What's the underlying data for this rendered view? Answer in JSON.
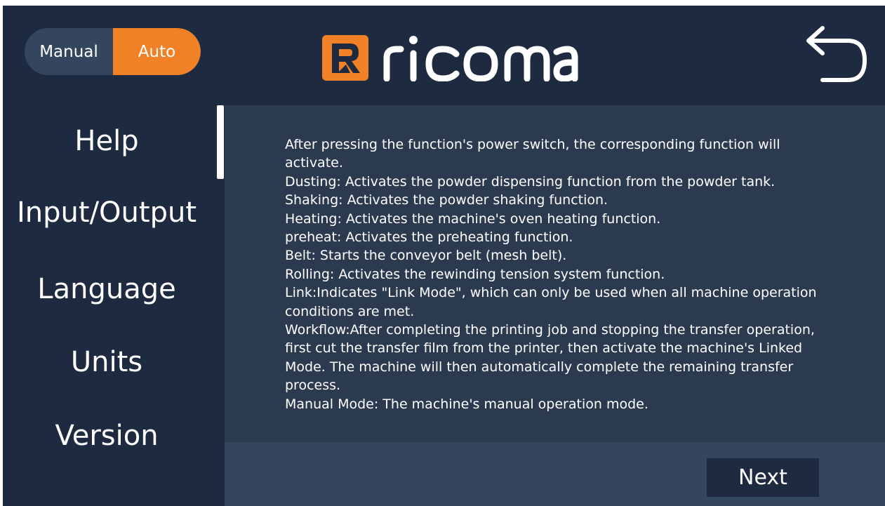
{
  "header": {
    "mode_toggle": {
      "manual_label": "Manual",
      "auto_label": "Auto",
      "active": "Auto"
    },
    "logo_text": "ricoma",
    "back_icon": "undo-arrow-icon"
  },
  "sidebar": {
    "items": [
      {
        "label": "Help",
        "active": true
      },
      {
        "label": "Input/Output",
        "active": false
      },
      {
        "label": "Language",
        "active": false
      },
      {
        "label": "Units",
        "active": false
      },
      {
        "label": "Version",
        "active": false
      }
    ]
  },
  "content": {
    "lines": [
      "After pressing the function's power switch, the corresponding function will activate.",
      "Dusting: Activates the powder dispensing function from the powder tank.",
      "Shaking: Activates the powder shaking function.",
      "Heating: Activates the machine's oven heating function.",
      "preheat: Activates the preheating function.",
      "Belt: Starts the conveyor belt (mesh belt).",
      "Rolling: Activates the rewinding tension system function.",
      "Link:Indicates \"Link Mode\", which can only be used when all machine operation conditions are met.",
      "Workflow:After completing the printing job and stopping the transfer operation, first cut the transfer film from the printer, then activate the machine's Linked Mode. The machine will then automatically complete the remaining transfer process.",
      "Manual Mode: The machine's manual operation mode."
    ]
  },
  "footer": {
    "next_label": "Next"
  },
  "colors": {
    "background": "#1e2a3f",
    "content_panel": "#2c3a50",
    "footer_bar": "#34465d",
    "accent": "#f08127",
    "text": "#ffffff"
  }
}
